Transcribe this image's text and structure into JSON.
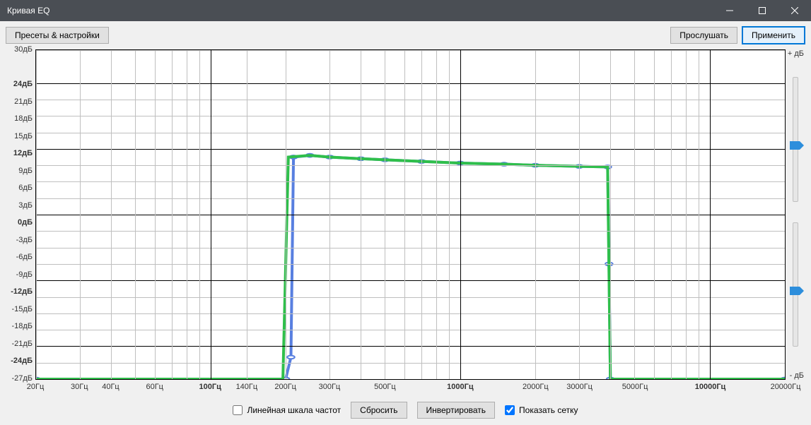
{
  "window": {
    "title": "Кривая EQ"
  },
  "toolbar": {
    "presets_label": "Пресеты & настройки",
    "preview_label": "Прослушать",
    "apply_label": "Применить"
  },
  "y_axis": {
    "ticks": [
      {
        "db": 30,
        "label": "30дБ",
        "bold": false
      },
      {
        "db": 24,
        "label": "24дБ",
        "bold": true
      },
      {
        "db": 21,
        "label": "21дБ",
        "bold": false
      },
      {
        "db": 18,
        "label": "18дБ",
        "bold": false
      },
      {
        "db": 15,
        "label": "15дБ",
        "bold": false
      },
      {
        "db": 12,
        "label": "12дБ",
        "bold": true
      },
      {
        "db": 9,
        "label": "9дБ",
        "bold": false
      },
      {
        "db": 6,
        "label": "6дБ",
        "bold": false
      },
      {
        "db": 3,
        "label": "3дБ",
        "bold": false
      },
      {
        "db": 0,
        "label": "0дБ",
        "bold": true
      },
      {
        "db": -3,
        "label": "-3дБ",
        "bold": false
      },
      {
        "db": -6,
        "label": "-6дБ",
        "bold": false
      },
      {
        "db": -9,
        "label": "-9дБ",
        "bold": false
      },
      {
        "db": -12,
        "label": "-12дБ",
        "bold": true
      },
      {
        "db": -15,
        "label": "-15дБ",
        "bold": false
      },
      {
        "db": -18,
        "label": "-18дБ",
        "bold": false
      },
      {
        "db": -21,
        "label": "-21дБ",
        "bold": false
      },
      {
        "db": -24,
        "label": "-24дБ",
        "bold": true
      },
      {
        "db": -27,
        "label": "-27дБ",
        "bold": false
      }
    ]
  },
  "x_axis": {
    "ticks": [
      {
        "hz": 20,
        "label": "20Гц",
        "bold": false
      },
      {
        "hz": 30,
        "label": "30Гц",
        "bold": false
      },
      {
        "hz": 40,
        "label": "40Гц",
        "bold": false
      },
      {
        "hz": 60,
        "label": "60Гц",
        "bold": false
      },
      {
        "hz": 100,
        "label": "100Гц",
        "bold": true
      },
      {
        "hz": 140,
        "label": "140Гц",
        "bold": false
      },
      {
        "hz": 200,
        "label": "200Гц",
        "bold": false
      },
      {
        "hz": 300,
        "label": "300Гц",
        "bold": false
      },
      {
        "hz": 500,
        "label": "500Гц",
        "bold": false
      },
      {
        "hz": 1000,
        "label": "1000Гц",
        "bold": true
      },
      {
        "hz": 2000,
        "label": "2000Гц",
        "bold": false
      },
      {
        "hz": 3000,
        "label": "3000Гц",
        "bold": false
      },
      {
        "hz": 5000,
        "label": "5000Гц",
        "bold": false
      },
      {
        "hz": 10000,
        "label": "10000Гц",
        "bold": true
      },
      {
        "hz": 20000,
        "label": "20000Гц",
        "bold": false
      }
    ]
  },
  "side": {
    "plus_label": "+ дБ",
    "minus_label": "- дБ"
  },
  "bottom": {
    "linear_label": "Линейная шкала частот",
    "linear_checked": false,
    "reset_label": "Сбросить",
    "invert_label": "Инвертировать",
    "grid_label": "Показать сетку",
    "grid_checked": true
  },
  "colors": {
    "curve_blue": "#587fe0",
    "curve_green": "#2fbf4b",
    "grid_minor": "#bfbfbf",
    "grid_major": "#000000"
  },
  "chart_data": {
    "type": "line",
    "xlabel": "",
    "ylabel": "дБ",
    "xlog": true,
    "xlim": [
      20,
      20000
    ],
    "ylim": [
      -30,
      30
    ],
    "series": [
      {
        "name": "blue-curve",
        "color": "#587fe0",
        "points": [
          {
            "hz": 20,
            "db": -30
          },
          {
            "hz": 200,
            "db": -30
          },
          {
            "hz": 210,
            "db": -26
          },
          {
            "hz": 215,
            "db": 10.5
          },
          {
            "hz": 250,
            "db": 10.8
          },
          {
            "hz": 300,
            "db": 10.5
          },
          {
            "hz": 400,
            "db": 10.2
          },
          {
            "hz": 500,
            "db": 10
          },
          {
            "hz": 700,
            "db": 9.7
          },
          {
            "hz": 1000,
            "db": 9.4
          },
          {
            "hz": 1500,
            "db": 9.2
          },
          {
            "hz": 2000,
            "db": 9
          },
          {
            "hz": 3000,
            "db": 8.8
          },
          {
            "hz": 3900,
            "db": 8.7
          },
          {
            "hz": 3950,
            "db": -9
          },
          {
            "hz": 4000,
            "db": -30
          },
          {
            "hz": 20000,
            "db": -30
          }
        ],
        "markers": true
      },
      {
        "name": "green-curve",
        "color": "#2fbf4b",
        "points": [
          {
            "hz": 20,
            "db": -30
          },
          {
            "hz": 195,
            "db": -30
          },
          {
            "hz": 205,
            "db": 10.5
          },
          {
            "hz": 250,
            "db": 10.8
          },
          {
            "hz": 300,
            "db": 10.5
          },
          {
            "hz": 400,
            "db": 10.2
          },
          {
            "hz": 500,
            "db": 10
          },
          {
            "hz": 700,
            "db": 9.7
          },
          {
            "hz": 1000,
            "db": 9.4
          },
          {
            "hz": 1500,
            "db": 9.2
          },
          {
            "hz": 2000,
            "db": 9
          },
          {
            "hz": 3000,
            "db": 8.8
          },
          {
            "hz": 3900,
            "db": 8.7
          },
          {
            "hz": 4000,
            "db": -30
          },
          {
            "hz": 20000,
            "db": -30
          }
        ],
        "markers": false
      }
    ]
  }
}
